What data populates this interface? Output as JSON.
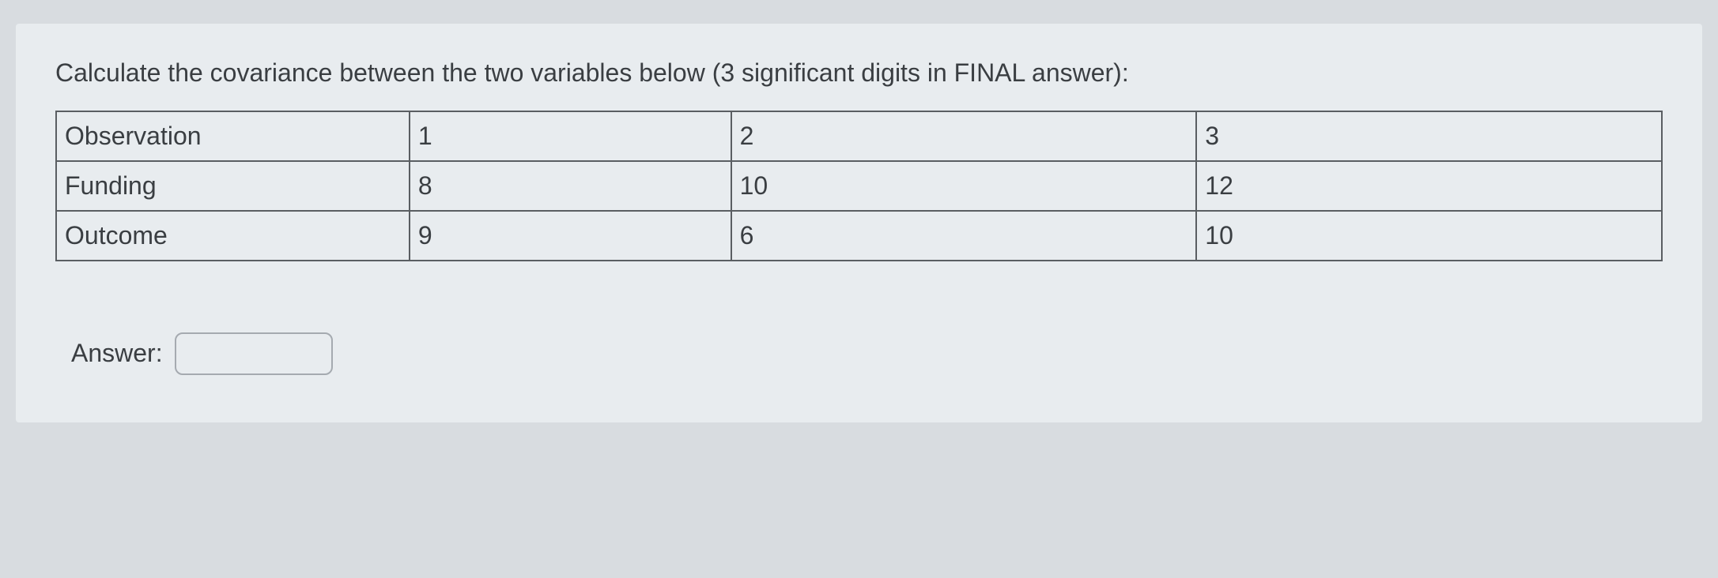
{
  "question": {
    "prompt": "Calculate the covariance between the two variables below (3 significant digits in FINAL answer):"
  },
  "table": {
    "rows": [
      {
        "label": "Observation",
        "c1": "1",
        "c2": "2",
        "c3": "3"
      },
      {
        "label": "Funding",
        "c1": "8",
        "c2": "10",
        "c3": "12"
      },
      {
        "label": "Outcome",
        "c1": "9",
        "c2": "6",
        "c3": "10"
      }
    ]
  },
  "answer": {
    "label": "Answer:",
    "value": ""
  }
}
